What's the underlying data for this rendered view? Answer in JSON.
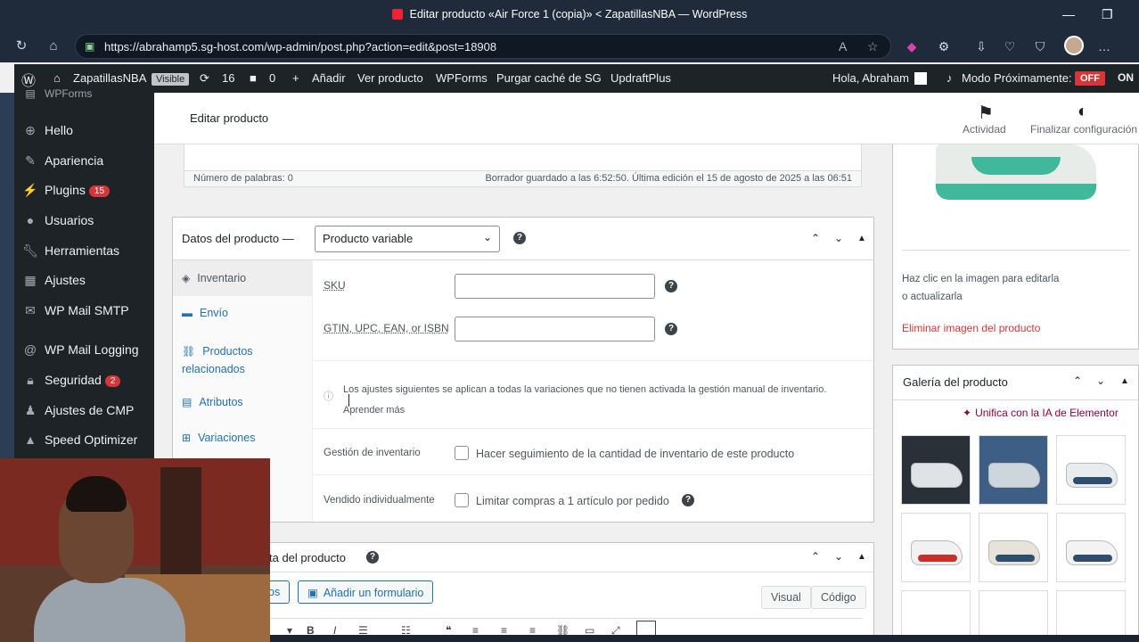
{
  "browser": {
    "tab_title": "Editar producto «Air Force 1 (copia)» < ZapatillasNBA — WordPress",
    "url": "https://abrahamp5.sg-host.com/wp-admin/post.php?action=edit&post=18908"
  },
  "adminbar": {
    "site": "ZapatillasNBA",
    "visible": "Visible",
    "updates": "16",
    "comments": "0",
    "add": "Añadir",
    "view_product": "Ver producto",
    "wpforms": "WPForms",
    "purge": "Purgar caché de SG",
    "updraft": "UpdraftPlus",
    "greeting": "Hola, Abraham",
    "coming_soon": "Modo Próximamente:",
    "off": "OFF",
    "on": "ON"
  },
  "sidebar": {
    "items": [
      {
        "label": "WPForms",
        "icon": "wpforms-icon"
      },
      {
        "label": "Hello",
        "icon": "plus-circle-icon"
      },
      {
        "label": "Apariencia",
        "icon": "brush-icon"
      },
      {
        "label": "Plugins",
        "icon": "plugin-icon",
        "count": "15"
      },
      {
        "label": "Usuarios",
        "icon": "user-icon"
      },
      {
        "label": "Herramientas",
        "icon": "wrench-icon"
      },
      {
        "label": "Ajustes",
        "icon": "settings-icon"
      },
      {
        "label": "WP Mail SMTP",
        "icon": "mail-icon"
      },
      {
        "label": "WP Mail Logging",
        "icon": "at-icon"
      },
      {
        "label": "Seguridad",
        "icon": "lock-icon",
        "count": "2"
      },
      {
        "label": "Ajustes de CMP",
        "icon": "cmp-icon"
      },
      {
        "label": "Speed Optimizer",
        "icon": "speed-icon"
      }
    ]
  },
  "editor": {
    "title": "Editar producto",
    "activity": "Actividad",
    "finish_setup": "Finalizar configuración"
  },
  "wordcount": {
    "words": "Número de palabras: 0",
    "saved": "Borrador guardado a las 6:52:50. Última edición el 15 de agosto de 2025 a las 06:51"
  },
  "product_data": {
    "label": "Datos del producto —",
    "type": "Producto variable",
    "tabs": [
      {
        "label": "Inventario",
        "icon": "tag-icon"
      },
      {
        "label": "Envío",
        "icon": "truck-icon"
      },
      {
        "label": "Productos relacionados",
        "icon": "link-icon"
      },
      {
        "label": "Atributos",
        "icon": "list-icon"
      },
      {
        "label": "Variaciones",
        "icon": "grid-icon"
      }
    ],
    "sku_label": "SKU",
    "gtin_label": "GTIN, UPC, EAN, or ISBN",
    "notice": "Los ajustes siguientes se aplican a todas la variaciones que no tienen activada la gestión manual de inventario.",
    "learn_more": "Aprender más",
    "stock_label": "Gestión de inventario",
    "stock_text": "Hacer seguimiento de la cantidad de inventario de este producto",
    "sold_label": "Vendido individualmente",
    "sold_text": "Limitar compras a 1 artículo por pedido"
  },
  "short_desc": {
    "title": "ta del producto",
    "media_btn": "os",
    "add_form": "Añadir un formulario",
    "visual": "Visual",
    "code": "Código"
  },
  "product_image": {
    "hint_line1": "Haz clic en la imagen para editarla",
    "hint_line2": "o actualizarla",
    "remove": "Eliminar imagen del producto"
  },
  "gallery": {
    "title": "Galería del producto",
    "ai_link": "Unifica con la IA de Elementor",
    "thumbs": [
      {
        "color": "#2a3038",
        "accent": "#dfe3e6"
      },
      {
        "color": "#3d5f86",
        "accent": "#cdd6dd"
      },
      {
        "color": "#e9ecef",
        "accent": "#2f4e6e"
      },
      {
        "color": "#f1f1f1",
        "accent": "#c9302c"
      },
      {
        "color": "#e7e3da",
        "accent": "#2f4e6e"
      },
      {
        "color": "#f3f3f3",
        "accent": "#2f4e6e"
      }
    ]
  }
}
